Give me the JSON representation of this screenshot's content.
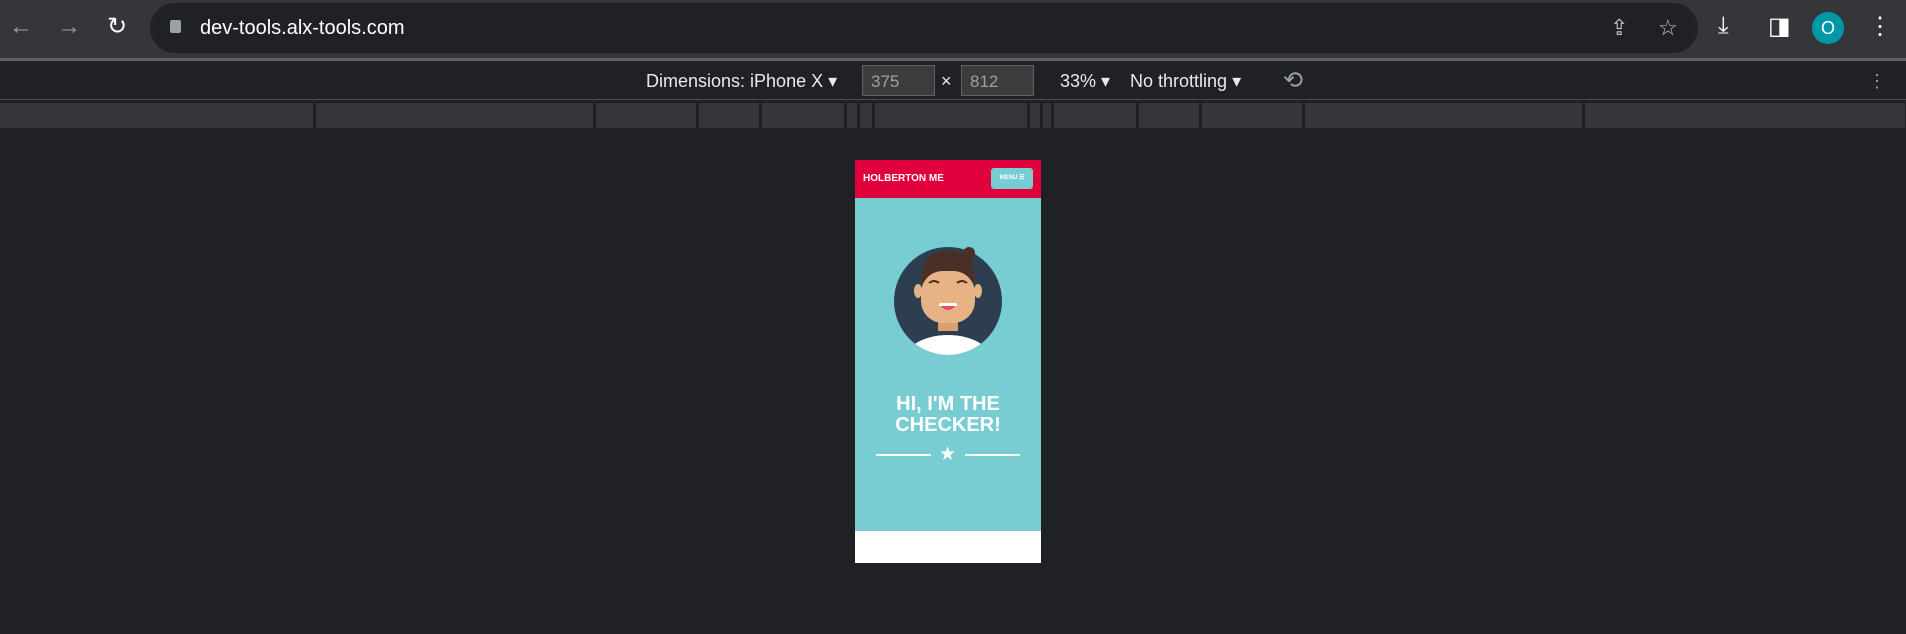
{
  "browser": {
    "url": "dev-tools.alx-tools.com",
    "profile_initial": "O"
  },
  "devtools": {
    "dimensions_label": "Dimensions: iPhone X",
    "width": "375",
    "height": "812",
    "times": "×",
    "zoom": "33%",
    "throttling": "No throttling"
  },
  "page": {
    "brand": "HOLBERTON ME",
    "menu_label": "MENU ☰",
    "title_line1": "HI, I'M THE",
    "title_line2": "CHECKER!",
    "colors": {
      "header": "#e0003c",
      "hero": "#78cdd2"
    }
  }
}
